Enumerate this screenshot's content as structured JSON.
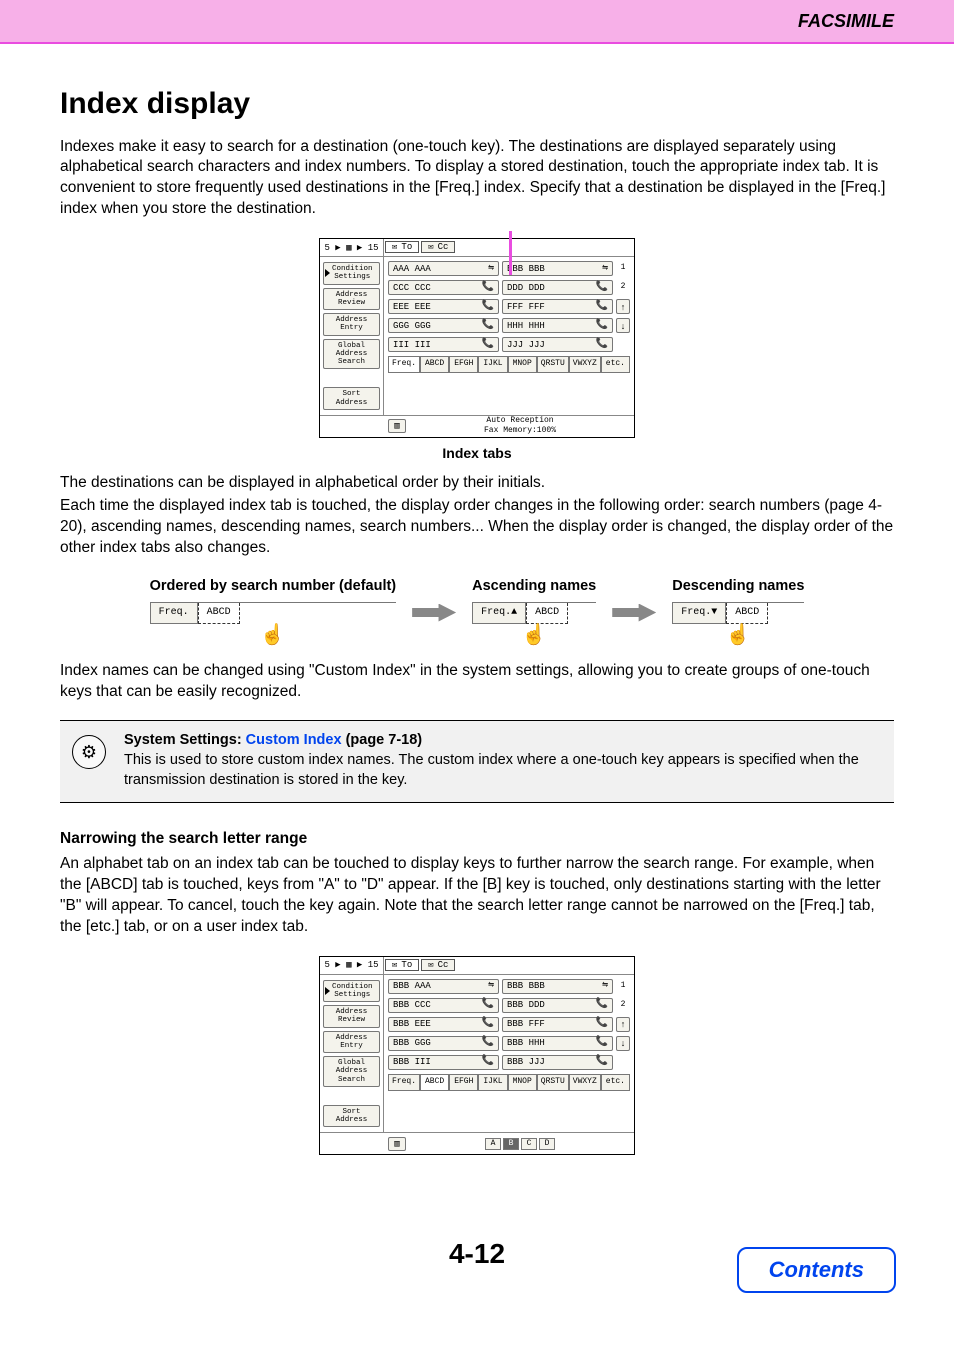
{
  "header": {
    "section": "FACSIMILE"
  },
  "heading": "Index display",
  "intro": "Indexes make it easy to search for a destination (one-touch key). The destinations are displayed separately using alphabetical search characters and index numbers. To display a stored destination, touch the appropriate index tab. It is convenient to store frequently used destinations in the [Freq.] index. Specify that a destination be displayed in the [Freq.] index when you store the destination.",
  "screenshot1": {
    "top_left": "5 ▶ ▦ ▶ 15",
    "tab_to": "To",
    "tab_cc": "Cc",
    "side": {
      "cond1": "Condition",
      "cond2": "Settings",
      "addr_rev": "Address Review",
      "addr_ent": "Address Entry",
      "glob1": "Global",
      "glob2": "Address Search",
      "sort": "Sort Address"
    },
    "addresses": [
      [
        "AAA AAA",
        "BBB BBB"
      ],
      [
        "CCC CCC",
        "DDD DDD"
      ],
      [
        "EEE EEE",
        "FFF FFF"
      ],
      [
        "GGG GGG",
        "HHH HHH"
      ],
      [
        "III III",
        "JJJ JJJ"
      ]
    ],
    "pages": [
      "1",
      "2"
    ],
    "index_tabs": [
      "Freq.",
      "ABCD",
      "EFGH",
      "IJKL",
      "MNOP",
      "QRSTU",
      "VWXYZ",
      "etc."
    ],
    "bottom": {
      "auto_rec": "Auto Reception",
      "fax_mem": "Fax Memory:100%"
    },
    "caption": "Index tabs"
  },
  "para2a": "The destinations can be displayed in alphabetical order by their initials.",
  "para2b": "Each time the displayed index tab is touched, the display order changes in the following order: search numbers (page 4-20), ascending names, descending names, search numbers... When the display order is changed, the display order of the other index tabs also changes.",
  "cols": {
    "h1": "Ordered by search number (default)",
    "h2": "Ascending names",
    "h3": "Descending names",
    "freq": "Freq.",
    "abcd": "ABCD"
  },
  "para3": "Index names can be changed using \"Custom Index\" in the system settings, allowing you to create groups of one-touch keys that can be easily recognized.",
  "info": {
    "title_pre": "System Settings: ",
    "title_link": "Custom Index",
    "title_post": " (page 7-18)",
    "body": "This is used to store custom index names. The custom index where a one-touch key appears is specified when the transmission destination is stored in the key."
  },
  "narrow": {
    "head": "Narrowing the search letter range",
    "body": "An alphabet tab on an index tab can be touched to display keys to further narrow the search range. For example, when the [ABCD] tab is touched, keys from \"A\" to \"D\" appear. If the [B] key is touched, only destinations starting with the letter \"B\" will appear. To cancel, touch the key again. Note that the search letter range cannot be narrowed on the [Freq.] tab, the [etc.] tab, or on a user index tab."
  },
  "screenshot2": {
    "addresses": [
      [
        "BBB AAA",
        "BBB BBB"
      ],
      [
        "BBB CCC",
        "BBB DDD"
      ],
      [
        "BBB EEE",
        "BBB FFF"
      ],
      [
        "BBB GGG",
        "BBB HHH"
      ],
      [
        "BBB III",
        "BBB JJJ"
      ]
    ],
    "sub_letters": [
      "A",
      "B",
      "C",
      "D"
    ]
  },
  "page_number": "4-12",
  "contents_btn": "Contents"
}
